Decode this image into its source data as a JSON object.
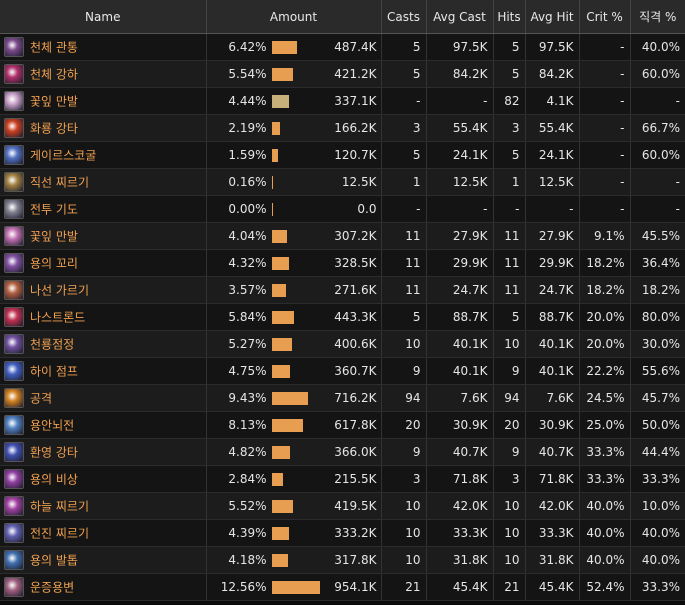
{
  "headers": {
    "name": "Name",
    "amount": "Amount",
    "casts": "Casts",
    "avg_cast": "Avg Cast",
    "hits": "Hits",
    "avg_hit": "Avg Hit",
    "crit": "Crit %",
    "direct": "직격 %"
  },
  "colors": {
    "bar": "#e89e50",
    "bar_alt": "#c8b07a",
    "skill_text": "#f0a050"
  },
  "rows": [
    {
      "icon": "sword-rain-icon",
      "name": "천체 관통",
      "pct": "6.42%",
      "pct_value": 6.42,
      "amount": "487.4K",
      "casts": "5",
      "avg_cast": "97.5K",
      "hits": "5",
      "avg_hit": "97.5K",
      "crit": "-",
      "direct": "40.0%",
      "icon_color": "#7a4a8a"
    },
    {
      "icon": "pink-orb-icon",
      "name": "천체 강하",
      "pct": "5.54%",
      "pct_value": 5.54,
      "amount": "421.2K",
      "casts": "5",
      "avg_cast": "84.2K",
      "hits": "5",
      "avg_hit": "84.2K",
      "crit": "-",
      "direct": "60.0%",
      "icon_color": "#b0306a"
    },
    {
      "icon": "petal-icon",
      "name": "꽃잎 만발",
      "pct": "4.44%",
      "pct_value": 4.44,
      "amount": "337.1K",
      "casts": "-",
      "avg_cast": "-",
      "hits": "82",
      "avg_hit": "4.1K",
      "crit": "-",
      "direct": "-",
      "icon_color": "#c8a0c8",
      "bar_alt": true
    },
    {
      "icon": "fire-dragon-icon",
      "name": "화룡 강타",
      "pct": "2.19%",
      "pct_value": 2.19,
      "amount": "166.2K",
      "casts": "3",
      "avg_cast": "55.4K",
      "hits": "3",
      "avg_hit": "55.4K",
      "crit": "-",
      "direct": "66.7%",
      "icon_color": "#c84020"
    },
    {
      "icon": "gale-icon",
      "name": "게이르스코굴",
      "pct": "1.59%",
      "pct_value": 1.59,
      "amount": "120.7K",
      "casts": "5",
      "avg_cast": "24.1K",
      "hits": "5",
      "avg_hit": "24.1K",
      "crit": "-",
      "direct": "60.0%",
      "icon_color": "#5070c0"
    },
    {
      "icon": "lance-icon",
      "name": "직선 찌르기",
      "pct": "0.16%",
      "pct_value": 0.16,
      "amount": "12.5K",
      "casts": "1",
      "avg_cast": "12.5K",
      "hits": "1",
      "avg_hit": "12.5K",
      "crit": "-",
      "direct": "-",
      "icon_color": "#a08040"
    },
    {
      "icon": "prayer-icon",
      "name": "전투 기도",
      "pct": "0.00%",
      "pct_value": 0.0,
      "amount": "0.0",
      "casts": "-",
      "avg_cast": "-",
      "hits": "-",
      "avg_hit": "-",
      "crit": "-",
      "direct": "-",
      "icon_color": "#808090"
    },
    {
      "icon": "petal-icon",
      "name": "꽃잎 만발",
      "pct": "4.04%",
      "pct_value": 4.04,
      "amount": "307.2K",
      "casts": "11",
      "avg_cast": "27.9K",
      "hits": "11",
      "avg_hit": "27.9K",
      "crit": "9.1%",
      "direct": "45.5%",
      "icon_color": "#c070b0"
    },
    {
      "icon": "dragon-tail-icon",
      "name": "용의 꼬리",
      "pct": "4.32%",
      "pct_value": 4.32,
      "amount": "328.5K",
      "casts": "11",
      "avg_cast": "29.9K",
      "hits": "11",
      "avg_hit": "29.9K",
      "crit": "18.2%",
      "direct": "36.4%",
      "icon_color": "#8050a0"
    },
    {
      "icon": "spiral-icon",
      "name": "나선 가르기",
      "pct": "3.57%",
      "pct_value": 3.57,
      "amount": "271.6K",
      "casts": "11",
      "avg_cast": "24.7K",
      "hits": "11",
      "avg_hit": "24.7K",
      "crit": "18.2%",
      "direct": "18.2%",
      "icon_color": "#b06040"
    },
    {
      "icon": "nastrond-icon",
      "name": "나스트론드",
      "pct": "5.84%",
      "pct_value": 5.84,
      "amount": "443.3K",
      "casts": "5",
      "avg_cast": "88.7K",
      "hits": "5",
      "avg_hit": "88.7K",
      "crit": "20.0%",
      "direct": "80.0%",
      "icon_color": "#c03050"
    },
    {
      "icon": "dragon-eye-icon",
      "name": "천룡점정",
      "pct": "5.27%",
      "pct_value": 5.27,
      "amount": "400.6K",
      "casts": "10",
      "avg_cast": "40.1K",
      "hits": "10",
      "avg_hit": "40.1K",
      "crit": "20.0%",
      "direct": "30.0%",
      "icon_color": "#7050a0"
    },
    {
      "icon": "high-jump-icon",
      "name": "하이 점프",
      "pct": "4.75%",
      "pct_value": 4.75,
      "amount": "360.7K",
      "casts": "9",
      "avg_cast": "40.1K",
      "hits": "9",
      "avg_hit": "40.1K",
      "crit": "22.2%",
      "direct": "55.6%",
      "icon_color": "#4060c0"
    },
    {
      "icon": "attack-icon",
      "name": "공격",
      "pct": "9.43%",
      "pct_value": 9.43,
      "amount": "716.2K",
      "casts": "94",
      "avg_cast": "7.6K",
      "hits": "94",
      "avg_hit": "7.6K",
      "crit": "24.5%",
      "direct": "45.7%",
      "icon_color": "#d08020"
    },
    {
      "icon": "dragon-thunder-icon",
      "name": "용안뇌전",
      "pct": "8.13%",
      "pct_value": 8.13,
      "amount": "617.8K",
      "casts": "20",
      "avg_cast": "30.9K",
      "hits": "20",
      "avg_hit": "30.9K",
      "crit": "25.0%",
      "direct": "50.0%",
      "icon_color": "#5080c0"
    },
    {
      "icon": "phantom-icon",
      "name": "환영 강타",
      "pct": "4.82%",
      "pct_value": 4.82,
      "amount": "366.0K",
      "casts": "9",
      "avg_cast": "40.7K",
      "hits": "9",
      "avg_hit": "40.7K",
      "crit": "33.3%",
      "direct": "44.4%",
      "icon_color": "#4050b0"
    },
    {
      "icon": "dragon-rise-icon",
      "name": "용의 비상",
      "pct": "2.84%",
      "pct_value": 2.84,
      "amount": "215.5K",
      "casts": "3",
      "avg_cast": "71.8K",
      "hits": "3",
      "avg_hit": "71.8K",
      "crit": "33.3%",
      "direct": "33.3%",
      "icon_color": "#9040a0"
    },
    {
      "icon": "sky-thrust-icon",
      "name": "하늘 찌르기",
      "pct": "5.52%",
      "pct_value": 5.52,
      "amount": "419.5K",
      "casts": "10",
      "avg_cast": "42.0K",
      "hits": "10",
      "avg_hit": "42.0K",
      "crit": "40.0%",
      "direct": "10.0%",
      "icon_color": "#a040a0"
    },
    {
      "icon": "advance-thrust-icon",
      "name": "전진 찌르기",
      "pct": "4.39%",
      "pct_value": 4.39,
      "amount": "333.2K",
      "casts": "10",
      "avg_cast": "33.3K",
      "hits": "10",
      "avg_hit": "33.3K",
      "crit": "40.0%",
      "direct": "40.0%",
      "icon_color": "#6060b0"
    },
    {
      "icon": "dragon-claw-icon",
      "name": "용의 발톱",
      "pct": "4.18%",
      "pct_value": 4.18,
      "amount": "317.8K",
      "casts": "10",
      "avg_cast": "31.8K",
      "hits": "10",
      "avg_hit": "31.8K",
      "crit": "40.0%",
      "direct": "40.0%",
      "icon_color": "#4070b0"
    },
    {
      "icon": "chaos-thrust-icon",
      "name": "운증용변",
      "pct": "12.56%",
      "pct_value": 12.56,
      "amount": "954.1K",
      "casts": "21",
      "avg_cast": "45.4K",
      "hits": "21",
      "avg_hit": "45.4K",
      "crit": "52.4%",
      "direct": "33.3%",
      "icon_color": "#a06080"
    }
  ]
}
